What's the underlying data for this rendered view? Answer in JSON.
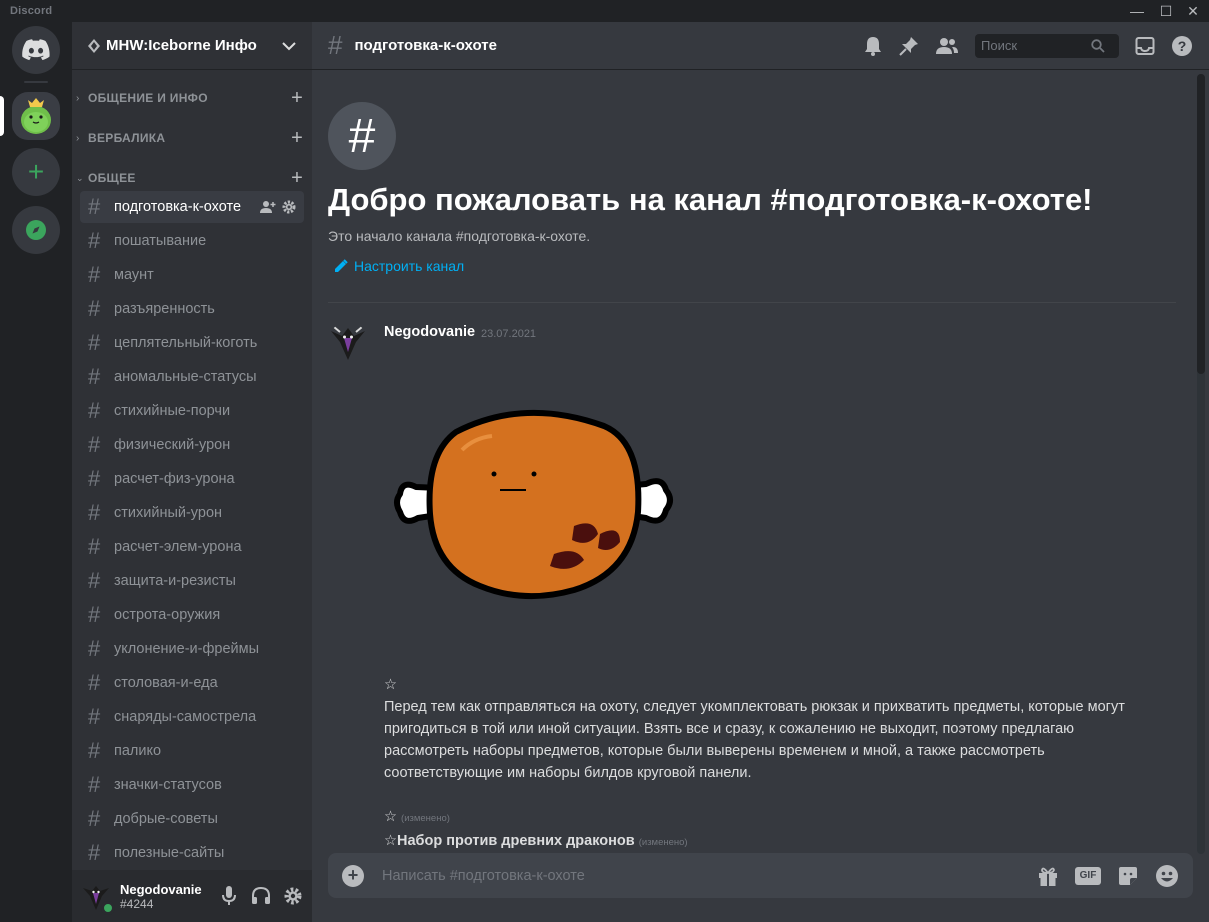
{
  "app": {
    "title": "Discord"
  },
  "server": {
    "name": "MHW:Iceborne Инфо"
  },
  "categories": [
    {
      "label": "ОБЩЕНИЕ И ИНФО"
    },
    {
      "label": "ВЕРБАЛИКА"
    },
    {
      "label": "ОБЩЕЕ"
    }
  ],
  "channels": [
    {
      "name": "подготовка-к-охоте"
    },
    {
      "name": "пошатывание"
    },
    {
      "name": "маунт"
    },
    {
      "name": "разъяренность"
    },
    {
      "name": "цеплятельный-коготь"
    },
    {
      "name": "аномальные-статусы"
    },
    {
      "name": "стихийные-порчи"
    },
    {
      "name": "физический-урон"
    },
    {
      "name": "расчет-физ-урона"
    },
    {
      "name": "стихийный-урон"
    },
    {
      "name": "расчет-элем-урона"
    },
    {
      "name": "защита-и-резисты"
    },
    {
      "name": "острота-оружия"
    },
    {
      "name": "уклонение-и-фреймы"
    },
    {
      "name": "столовая-и-еда"
    },
    {
      "name": "снаряды-самострела"
    },
    {
      "name": "палико"
    },
    {
      "name": "значки-статусов"
    },
    {
      "name": "добрые-советы"
    },
    {
      "name": "полезные-сайты"
    }
  ],
  "user": {
    "name": "Negodovanie",
    "tag": "#4244"
  },
  "topbar": {
    "channel": "подготовка-к-охоте",
    "search_placeholder": "Поиск"
  },
  "welcome": {
    "title": "Добро пожаловать на канал #подготовка-к-охоте!",
    "subtitle": "Это начало канала #подготовка-к-охоте.",
    "link": "Настроить канал"
  },
  "message": {
    "author": "Negodovanie",
    "timestamp": "23.07.2021",
    "star": "☆",
    "paragraph": "Перед тем как отправляться на охоту, следует укомплектовать рюкзак и прихватить предметы, которые могут пригодиться в той или иной ситуации. Взять все и сразу, к сожалению не выходит, поэтому предлагаю рассмотреть наборы предметов, которые были выверены временем и мной, а также рассмотреть соответствующие им наборы билдов круговой панели.",
    "star2": "☆",
    "edited_label": "(изменено)",
    "heading": "☆Набор против древних драконов",
    "edited_label2": "(изменено)"
  },
  "composer": {
    "placeholder": "Написать #подготовка-к-охоте",
    "gif_label": "GIF"
  },
  "colors": {
    "accent": "#00b0f4",
    "online": "#3ba55d",
    "brand": "#5865f2"
  }
}
